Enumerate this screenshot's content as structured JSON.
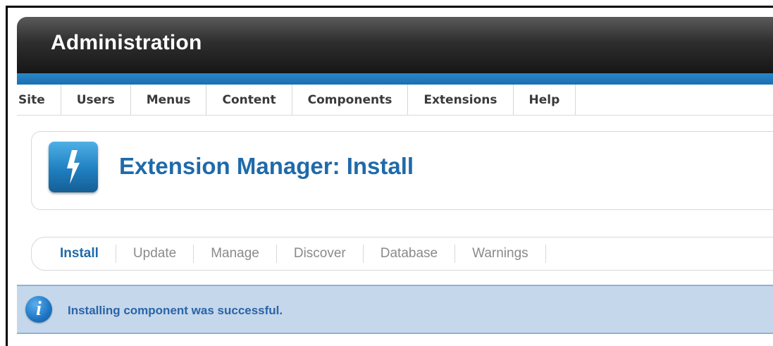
{
  "header": {
    "title": "Administration"
  },
  "menu": [
    {
      "label": "Site"
    },
    {
      "label": "Users"
    },
    {
      "label": "Menus"
    },
    {
      "label": "Content"
    },
    {
      "label": "Components"
    },
    {
      "label": "Extensions"
    },
    {
      "label": "Help"
    }
  ],
  "page": {
    "title": "Extension Manager: Install",
    "icon": "lightning-bolt-icon"
  },
  "tabs": [
    {
      "label": "Install",
      "active": true
    },
    {
      "label": "Update"
    },
    {
      "label": "Manage"
    },
    {
      "label": "Discover"
    },
    {
      "label": "Database"
    },
    {
      "label": "Warnings"
    }
  ],
  "message": {
    "icon": "info-icon",
    "text": "Installing component was successful."
  },
  "colors": {
    "accent": "#1f6aaa",
    "header_stripe": "#2a86c8",
    "message_bg": "#c5d7ea"
  }
}
